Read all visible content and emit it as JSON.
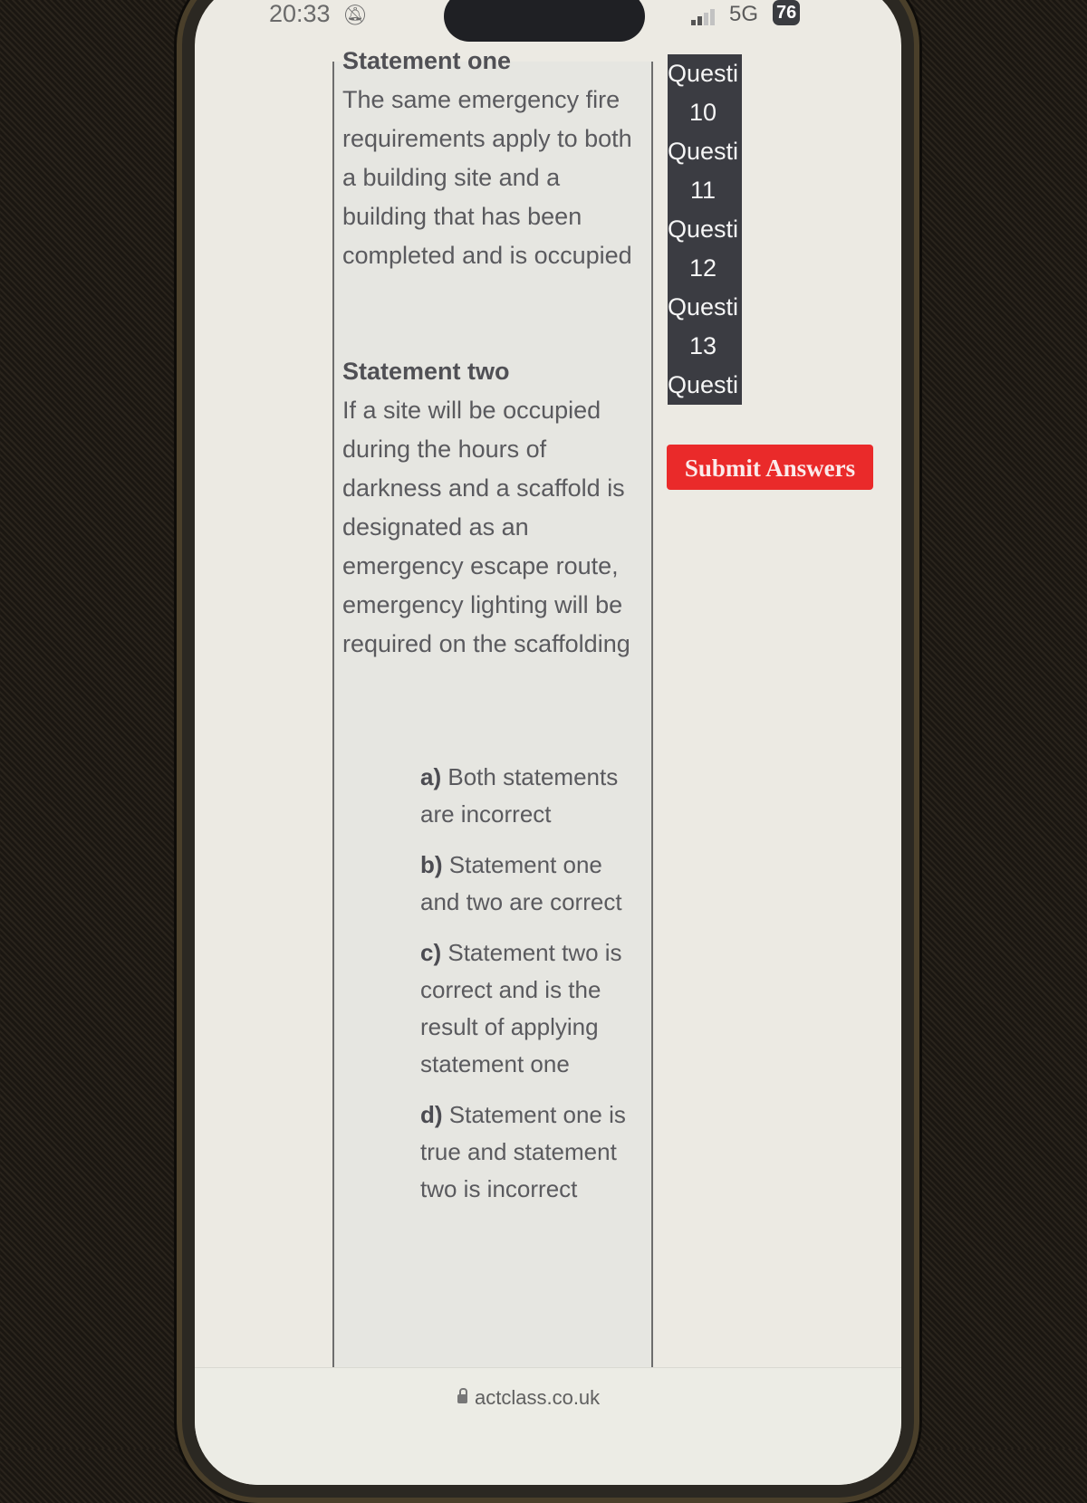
{
  "status_bar": {
    "time": "20:33",
    "silent_icon": "bell-slash-icon",
    "signal_icon": "cellular-signal-icon",
    "network": "5G",
    "battery": "76"
  },
  "statement_one": {
    "heading": "Statement one",
    "text": "The same emergency fire requirements apply to both a building site and a building that has been completed and is occupied"
  },
  "statement_two": {
    "heading": "Statement two",
    "text": "If a site will be occupied during the hours of darkness and a scaffold is designated as an emergency escape route, emergency lighting will be required on the scaffolding"
  },
  "options": [
    {
      "letter": "a)",
      "text": "Both statements are incorrect"
    },
    {
      "letter": "b)",
      "text": "Statement one and two are correct"
    },
    {
      "letter": "c)",
      "text": "Statement two is correct and is the result of applying statement one"
    },
    {
      "letter": "d)",
      "text": "Statement one is true and statement two is incorrect"
    }
  ],
  "question_nav": {
    "label": "Questi",
    "items": [
      "10",
      "11",
      "12",
      "13"
    ]
  },
  "submit_label": "Submit Answers",
  "browser": {
    "url": "actclass.co.uk",
    "lock_icon": "lock-icon"
  },
  "colors": {
    "submit_bg": "#ea2a2a",
    "nav_bg": "#3b3c42"
  }
}
